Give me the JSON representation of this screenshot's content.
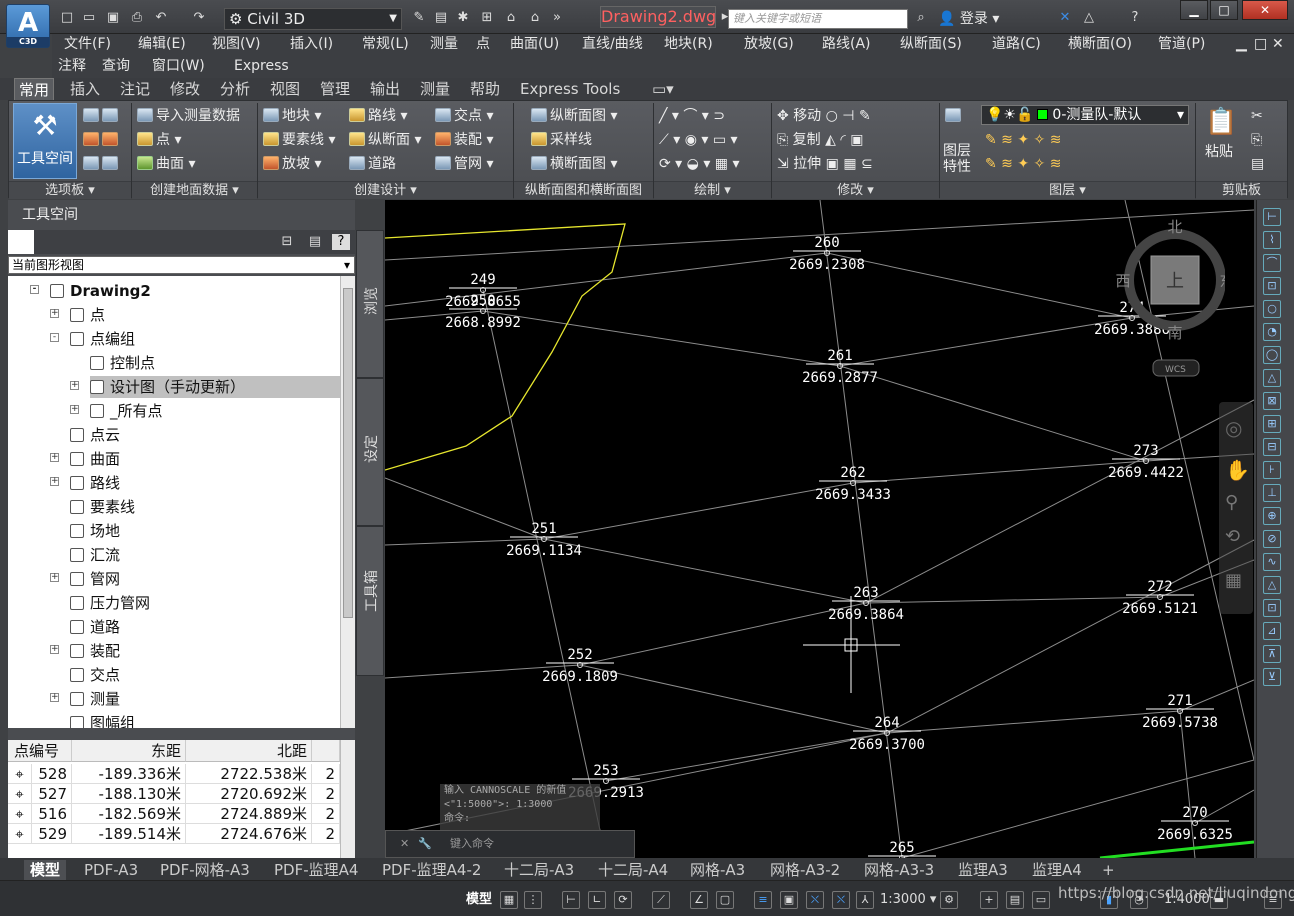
{
  "app": {
    "icon_label": "C3D",
    "workspace": "Civil 3D",
    "document_title": "Drawing2.dwg",
    "search_placeholder": "键入关键字或短语",
    "login": "登录"
  },
  "menus": [
    "文件(F)",
    "编辑(E)",
    "视图(V)",
    "插入(I)",
    "常规(L)",
    "测量",
    "点",
    "曲面(U)",
    "直线/曲线",
    "地块(R)",
    "放坡(G)",
    "路线(A)",
    "纵断面(S)",
    "道路(C)",
    "横断面(O)",
    "管道(P)",
    "注释",
    "查询",
    "窗口(W)",
    "Express"
  ],
  "ribbon_tabs": [
    "常用",
    "插入",
    "注记",
    "修改",
    "分析",
    "视图",
    "管理",
    "输出",
    "测量",
    "帮助",
    "Express Tools"
  ],
  "ribbon": {
    "tool_space": "工具空间",
    "import_survey": "导入测量数据",
    "point": "点",
    "surface": "曲面",
    "parcel": "地块",
    "feature_line": "要素线",
    "grading": "放坡",
    "alignment": "路线",
    "profile": "纵断面",
    "corridor": "道路",
    "intersection": "交点",
    "assembly": "装配",
    "pipe_network": "管网",
    "profile_view": "纵断面图",
    "sample_line": "采样线",
    "section_view": "横断面图",
    "move": "移动",
    "copy": "复制",
    "stretch": "拉伸",
    "layer_props": "图层特性",
    "layer_current": "0-测量队-默认",
    "paste": "粘贴",
    "panels": [
      "选项板",
      "创建地面数据",
      "创建设计",
      "纵断面图和横断面图",
      "绘制",
      "修改",
      "图层",
      "剪贴板"
    ]
  },
  "palette": {
    "title": "工具空间",
    "view_select": "当前图形视图",
    "vtabs": [
      "浏览",
      "设定",
      "工具箱"
    ],
    "tree": [
      {
        "label": "Drawing2",
        "level": 0,
        "bold": true,
        "pm": "-"
      },
      {
        "label": "点",
        "level": 1,
        "pm": "+"
      },
      {
        "label": "点编组",
        "level": 1,
        "pm": "-"
      },
      {
        "label": "控制点",
        "level": 2,
        "pm": ""
      },
      {
        "label": "设计图（手动更新）",
        "level": 2,
        "pm": "+",
        "selected": true
      },
      {
        "label": "_所有点",
        "level": 2,
        "pm": "+"
      },
      {
        "label": "点云",
        "level": 1,
        "pm": ""
      },
      {
        "label": "曲面",
        "level": 1,
        "pm": "+"
      },
      {
        "label": "路线",
        "level": 1,
        "pm": "+"
      },
      {
        "label": "要素线",
        "level": 1,
        "pm": ""
      },
      {
        "label": "场地",
        "level": 1,
        "pm": ""
      },
      {
        "label": "汇流",
        "level": 1,
        "pm": ""
      },
      {
        "label": "管网",
        "level": 1,
        "pm": "+"
      },
      {
        "label": "压力管网",
        "level": 1,
        "pm": ""
      },
      {
        "label": "道路",
        "level": 1,
        "pm": ""
      },
      {
        "label": "装配",
        "level": 1,
        "pm": "+"
      },
      {
        "label": "交点",
        "level": 1,
        "pm": ""
      },
      {
        "label": "测量",
        "level": 1,
        "pm": "+"
      },
      {
        "label": "图幅组",
        "level": 1,
        "pm": ""
      }
    ],
    "table": {
      "headers": [
        "点编号",
        "东距",
        "北距"
      ],
      "rows": [
        [
          "528",
          "-189.336米",
          "2722.538米"
        ],
        [
          "527",
          "-188.130米",
          "2720.692米"
        ],
        [
          "516",
          "-182.569米",
          "2724.889米"
        ],
        [
          "529",
          "-189.514米",
          "2724.676米"
        ]
      ]
    }
  },
  "viewcube": {
    "north": "北",
    "south": "南",
    "west": "西",
    "east": "东",
    "top": "上",
    "wcs": "WCS"
  },
  "cad_points": [
    {
      "id": "249",
      "elev": "2669.8655"
    },
    {
      "id": "250",
      "elev": "2668.8992"
    },
    {
      "id": "260",
      "elev": "2669.2308"
    },
    {
      "id": "261",
      "elev": "2669.2877"
    },
    {
      "id": "262",
      "elev": "2669.3433"
    },
    {
      "id": "263",
      "elev": "2669.3864"
    },
    {
      "id": "264",
      "elev": "2669.3700"
    },
    {
      "id": "265",
      "elev": ""
    },
    {
      "id": "251",
      "elev": "2669.1134"
    },
    {
      "id": "252",
      "elev": "2669.1809"
    },
    {
      "id": "253",
      "elev": "2669.2913"
    },
    {
      "id": "274",
      "elev": "2669.3886"
    },
    {
      "id": "273",
      "elev": "2669.4422"
    },
    {
      "id": "272",
      "elev": "2669.5121"
    },
    {
      "id": "271",
      "elev": "2669.5738"
    },
    {
      "id": "270",
      "elev": "2669.6325"
    }
  ],
  "command": {
    "history_1": "输入 CANNOSCALE 的新值",
    "history_2": "<\"1:5000\">: 1:3000",
    "history_3": "命令:",
    "placeholder": "键入命令"
  },
  "layout_tabs": [
    "模型",
    "PDF-A3",
    "PDF-网格-A3",
    "PDF-监理A4",
    "PDF-监理A4-2",
    "十二局-A3",
    "十二局-A4",
    "网格-A3",
    "网格-A3-2",
    "网格-A3-3",
    "监理A3",
    "监理A4"
  ],
  "status": {
    "model": "模型",
    "scale1": "1:3000",
    "scale2": "1:4000",
    "watermark": "https://blog.csdn.net/liuqindong"
  },
  "colors": {
    "canvas": "#000000",
    "boundary": "#e6e62e",
    "lines": "#8c8c8c",
    "labels": "#ffffff",
    "green_line": "#22dd22",
    "accent": "#2f64a0"
  }
}
